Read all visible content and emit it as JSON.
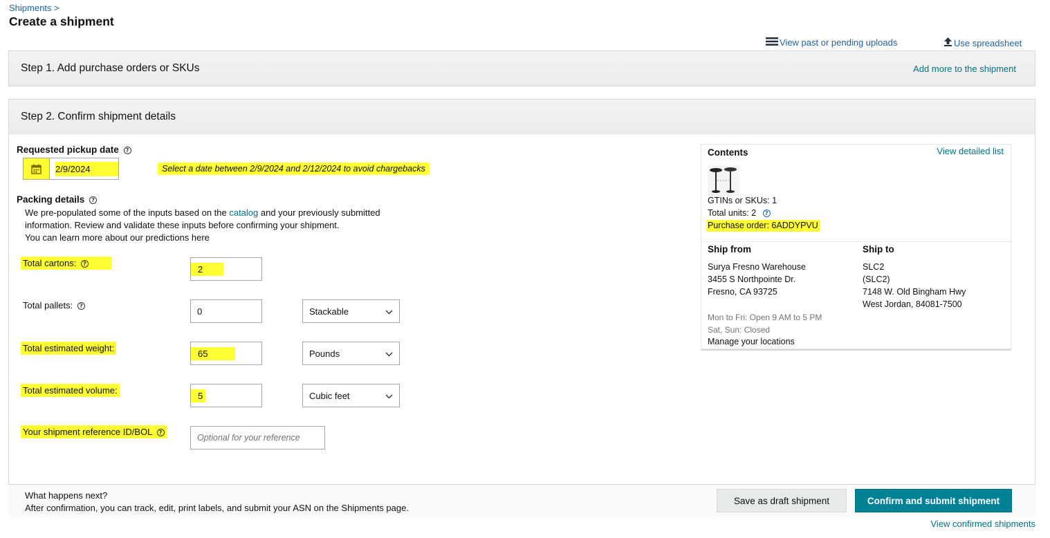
{
  "breadcrumb": "Shipments >",
  "title": "Create a shipment",
  "top_links": {
    "view_uploads": "View past or pending uploads",
    "use_spreadsheet": "Use spreadsheet"
  },
  "step1": {
    "title": "Step 1. Add purchase orders or SKUs",
    "link": "Add more to the shipment"
  },
  "step2": {
    "title": "Step 2. Confirm shipment details",
    "pickup": {
      "label": "Requested pickup date",
      "value": "2/9/2024",
      "hint": "Select a date between 2/9/2024 and 2/12/2024 to avoid chargebacks"
    },
    "packing": {
      "label": "Packing details",
      "desc_line1_pre": "We pre-populated some of the inputs based on the ",
      "desc_catalog": "catalog",
      "desc_line1_post": " and your previously submitted",
      "desc_line2": "information. Review and validate these inputs before confirming your shipment.",
      "learn_more": "You can learn more about our predictions here"
    },
    "fields": {
      "cartons_label": "Total cartons:",
      "cartons_value": "2",
      "pallets_label": "Total pallets:",
      "pallets_value": "0",
      "pallets_type": "Stackable",
      "weight_label": "Total estimated weight:",
      "weight_value": "65",
      "weight_unit": "Pounds",
      "volume_label": "Total estimated volume:",
      "volume_value": "5",
      "volume_unit": "Cubic feet",
      "ref_label": "Your shipment reference ID/BOL",
      "ref_placeholder": "Optional for your reference"
    }
  },
  "contents": {
    "title": "Contents",
    "view_list": "View detailed list",
    "gtins": "GTINs or SKUs: 1",
    "total_units": "Total units: 2",
    "purchase_order": "Purchase order: 6ADDYPVU",
    "ship_from_label": "Ship from",
    "ship_from_lines": [
      "Surya Fresno Warehouse",
      "3455 S Northpointe Dr.",
      "Fresno, CA 93725"
    ],
    "hours_1": "Mon to Fri: Open 9 AM to 5 PM",
    "hours_2": "Sat, Sun: Closed",
    "manage_locations": "Manage your locations",
    "ship_to_label": "Ship to",
    "ship_to_lines": [
      "SLC2",
      "(SLC2)",
      "7148 W. Old Bingham Hwy",
      "West Jordan,  84081-7500"
    ]
  },
  "footer": {
    "question": "What happens next?",
    "text": "After confirmation, you can track, edit, print labels, and submit your ASN on the Shipments page.",
    "draft_button": "Save as draft shipment",
    "confirm_button": "Confirm and submit shipment",
    "view_confirmed": "View confirmed shipments"
  },
  "colors": {
    "link": "#2162a1",
    "teal_link": "#007185",
    "primary_button": "#008296",
    "highlight": "#ffff33"
  }
}
